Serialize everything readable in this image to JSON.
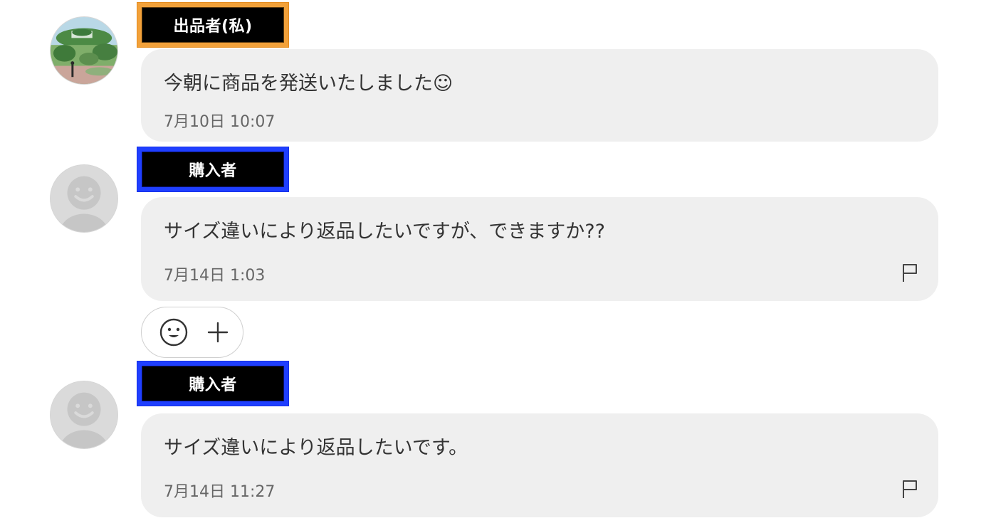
{
  "messages": [
    {
      "role_label": "出品者(私)",
      "role": "seller",
      "avatar_icon": "landscape-photo-avatar",
      "text": "今朝に商品を発送いたしました☺",
      "time": "7月10日 10:07",
      "has_flag": false
    },
    {
      "role_label": "購入者",
      "role": "buyer",
      "avatar_icon": "default-user-avatar",
      "text": "サイズ違いにより返品したいですが、できますか??",
      "time": "7月14日 1:03",
      "has_flag": true
    },
    {
      "role_label": "購入者",
      "role": "buyer",
      "avatar_icon": "default-user-avatar",
      "text": "サイズ違いにより返品したいです。",
      "time": "7月14日 11:27",
      "has_flag": true
    }
  ],
  "reaction_bar": {
    "icons": [
      "smiley-icon",
      "plus-icon"
    ]
  },
  "colors": {
    "seller_label_border": "#f2a13a",
    "buyer_label_border": "#1f3fff",
    "label_background": "#000000",
    "bubble_background": "#efefef",
    "time_text": "#666666"
  }
}
